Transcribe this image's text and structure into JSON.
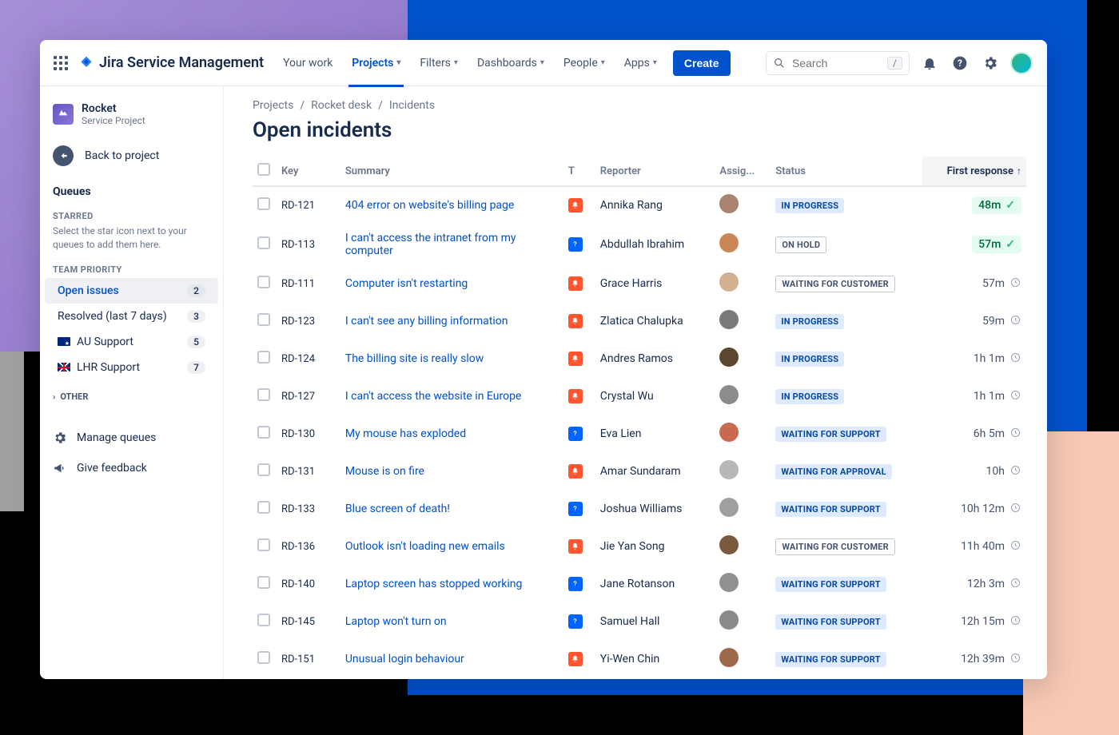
{
  "brand": "Jira Service Management",
  "nav": {
    "your_work": "Your work",
    "projects": "Projects",
    "filters": "Filters",
    "dashboards": "Dashboards",
    "people": "People",
    "apps": "Apps",
    "create": "Create"
  },
  "search": {
    "placeholder": "Search",
    "shortcut": "/"
  },
  "sidebar": {
    "project_name": "Rocket",
    "project_sub": "Service Project",
    "back": "Back to project",
    "queues": "Queues",
    "starred_heading": "STARRED",
    "starred_desc": "Select the star icon next to your queues to add them here.",
    "team_heading": "TEAM PRIORITY",
    "items": [
      {
        "label": "Open issues",
        "count": "2",
        "flag": "",
        "selected": true
      },
      {
        "label": "Resolved (last 7 days)",
        "count": "3",
        "flag": "",
        "selected": false
      },
      {
        "label": "AU Support",
        "count": "5",
        "flag": "au",
        "selected": false
      },
      {
        "label": "LHR Support",
        "count": "7",
        "flag": "uk",
        "selected": false
      }
    ],
    "other": "OTHER",
    "manage": "Manage queues",
    "feedback": "Give feedback"
  },
  "breadcrumbs": [
    "Projects",
    "Rocket desk",
    "Incidents"
  ],
  "page_title": "Open incidents",
  "columns": {
    "key": "Key",
    "summary": "Summary",
    "type": "T",
    "reporter": "Reporter",
    "assignee": "Assig...",
    "status": "Status",
    "first_response": "First response"
  },
  "rows": [
    {
      "key": "RD-121",
      "summary": "404 error on website's billing page",
      "type": "orange",
      "reporter": "Annika Rang",
      "status": "IN PROGRESS",
      "status_kind": "inprog",
      "resp": "48m",
      "resp_kind": "ok",
      "avatar": "#a9836f"
    },
    {
      "key": "RD-113",
      "summary": "I can't access the intranet from my computer",
      "type": "blue",
      "reporter": "Abdullah Ibrahim",
      "status": "ON HOLD",
      "status_kind": "hold",
      "resp": "57m",
      "resp_kind": "ok",
      "avatar": "#ca8756"
    },
    {
      "key": "RD-111",
      "summary": "Computer isn't restarting",
      "type": "orange",
      "reporter": "Grace Harris",
      "status": "WAITING FOR CUSTOMER",
      "status_kind": "waitcust",
      "resp": "57m",
      "resp_kind": "clock",
      "avatar": "#d2b090"
    },
    {
      "key": "RD-123",
      "summary": "I can't see any billing information",
      "type": "orange",
      "reporter": "Zlatica Chalupka",
      "status": "IN PROGRESS",
      "status_kind": "inprog",
      "resp": "59m",
      "resp_kind": "clock",
      "avatar": "#7a7a7a"
    },
    {
      "key": "RD-124",
      "summary": "The billing site is really slow",
      "type": "orange",
      "reporter": "Andres Ramos",
      "status": "IN PROGRESS",
      "status_kind": "inprog",
      "resp": "1h 1m",
      "resp_kind": "clock",
      "avatar": "#5b4630"
    },
    {
      "key": "RD-127",
      "summary": "I can't access the website in Europe",
      "type": "orange",
      "reporter": "Crystal Wu",
      "status": "IN PROGRESS",
      "status_kind": "inprog",
      "resp": "1h 1m",
      "resp_kind": "clock",
      "avatar": "#8c8c8c"
    },
    {
      "key": "RD-130",
      "summary": "My mouse has exploded",
      "type": "blue",
      "reporter": "Eva Lien",
      "status": "WAITING FOR SUPPORT",
      "status_kind": "waitsupp",
      "resp": "6h 5m",
      "resp_kind": "clock",
      "avatar": "#c96a4f"
    },
    {
      "key": "RD-131",
      "summary": "Mouse is on fire",
      "type": "orange",
      "reporter": "Amar Sundaram",
      "status": "WAITING FOR APPROVAL",
      "status_kind": "waitappr",
      "resp": "10h",
      "resp_kind": "clock",
      "avatar": "#b7b7b7"
    },
    {
      "key": "RD-133",
      "summary": "Blue screen of death!",
      "type": "blue",
      "reporter": "Joshua Williams",
      "status": "WAITING FOR SUPPORT",
      "status_kind": "waitsupp",
      "resp": "10h 12m",
      "resp_kind": "clock",
      "avatar": "#a0a0a0"
    },
    {
      "key": "RD-136",
      "summary": "Outlook isn't loading new emails",
      "type": "orange",
      "reporter": "Jie Yan Song",
      "status": "WAITING FOR CUSTOMER",
      "status_kind": "waitcust",
      "resp": "11h 40m",
      "resp_kind": "clock",
      "avatar": "#7a5a3c"
    },
    {
      "key": "RD-140",
      "summary": "Laptop screen has stopped working",
      "type": "blue",
      "reporter": "Jane Rotanson",
      "status": "WAITING FOR SUPPORT",
      "status_kind": "waitsupp",
      "resp": "12h 3m",
      "resp_kind": "clock",
      "avatar": "#909090"
    },
    {
      "key": "RD-145",
      "summary": "Laptop won't turn on",
      "type": "blue",
      "reporter": "Samuel Hall",
      "status": "WAITING FOR SUPPORT",
      "status_kind": "waitsupp",
      "resp": "12h 15m",
      "resp_kind": "clock",
      "avatar": "#8a8a8a"
    },
    {
      "key": "RD-151",
      "summary": "Unusual login behaviour",
      "type": "orange",
      "reporter": "Yi-Wen Chin",
      "status": "WAITING FOR SUPPORT",
      "status_kind": "waitsupp",
      "resp": "12h 39m",
      "resp_kind": "clock",
      "avatar": "#9c6a4a"
    }
  ]
}
